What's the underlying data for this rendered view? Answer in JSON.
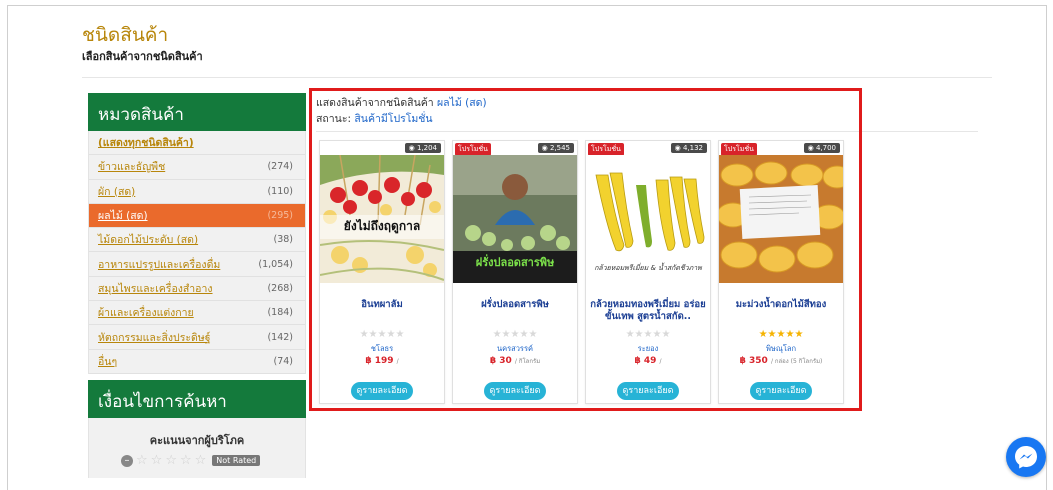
{
  "header": {
    "title": "ชนิดสินค้า",
    "subtitle": "เลือกสินค้าจากชนิดสินค้า"
  },
  "sidebar": {
    "heading": "หมวดสินค้า",
    "items": [
      {
        "label": "(แสดงทุกชนิดสินค้า)",
        "count": ""
      },
      {
        "label": "ข้าวและธัญพืช",
        "count": "(274)"
      },
      {
        "label": "ผัก (สด)",
        "count": "(110)"
      },
      {
        "label": "ผลไม้ (สด)",
        "count": "(295)"
      },
      {
        "label": "ไม้ดอกไม้ประดับ (สด)",
        "count": "(38)"
      },
      {
        "label": "อาหารแปรรูปและเครื่องดื่ม",
        "count": "(1,054)"
      },
      {
        "label": "สมุนไพรและเครื่องสำอาง",
        "count": "(268)"
      },
      {
        "label": "ผ้าและเครื่องแต่งกาย",
        "count": "(184)"
      },
      {
        "label": "หัตถกรรมและสิ่งประดิษฐ์",
        "count": "(142)"
      },
      {
        "label": "อื่นๆ",
        "count": "(74)"
      }
    ],
    "filter_heading": "เงื่อนไขการค้นหา",
    "filter_label": "คะแนนจากผู้บริโภค",
    "not_rated": "Not Rated"
  },
  "main": {
    "info_prefix": "แสดงสินค้าจากชนิดสินค้า",
    "info_category": "ผลไม้ (สด)",
    "status_prefix": "สถานะ:",
    "status_value": "สินค้ามีโปรโมชั่น"
  },
  "products": [
    {
      "name": "อินทผาลัม",
      "views": "1,204",
      "promo": "",
      "seller": "ชโลธร",
      "price": "฿ 199",
      "unit": "/",
      "stars": "★★★★★",
      "rated": false,
      "button": "ดูรายละเอียด",
      "image_text": "ยังไม่ถึงฤดูกาล"
    },
    {
      "name": "ฝรั่งปลอดสารพิษ",
      "views": "2,545",
      "promo": "โปรโมชั่น",
      "seller": "นครสวรรค์",
      "price": "฿ 30",
      "unit": "/ กิโลกรัม",
      "stars": "★★★★★",
      "rated": false,
      "button": "ดูรายละเอียด",
      "image_text": "ฝรั่งปลอดสารพิษ"
    },
    {
      "name": "กล้วยหอมทองพรีเมี่ยม อร่อยขั้นเทพ สูตรน้ำสกัด..",
      "views": "4,132",
      "promo": "โปรโมชั่น",
      "seller": "ระยอง",
      "price": "฿ 49",
      "unit": "/",
      "stars": "★★★★★",
      "rated": false,
      "button": "ดูรายละเอียด",
      "image_text": "กล้วยหอมพรีเมี่ยม & น้ำสกัดชีวภาพ"
    },
    {
      "name": "มะม่วงน้ำดอกไม้สีทอง",
      "views": "4,700",
      "promo": "โปรโมชั่น",
      "seller": "พิษณุโลก",
      "price": "฿ 350",
      "unit": "/ กล่อง (5 กิโลกรัม)",
      "stars": "★★★★★",
      "rated": true,
      "button": "ดูรายละเอียด",
      "image_text": ""
    }
  ],
  "colors": {
    "green": "#147a3c",
    "orange_active": "#ea6a2c",
    "link_gold": "#b8860b",
    "highlight_red": "#e01b1b",
    "button_blue": "#27b3d6"
  }
}
